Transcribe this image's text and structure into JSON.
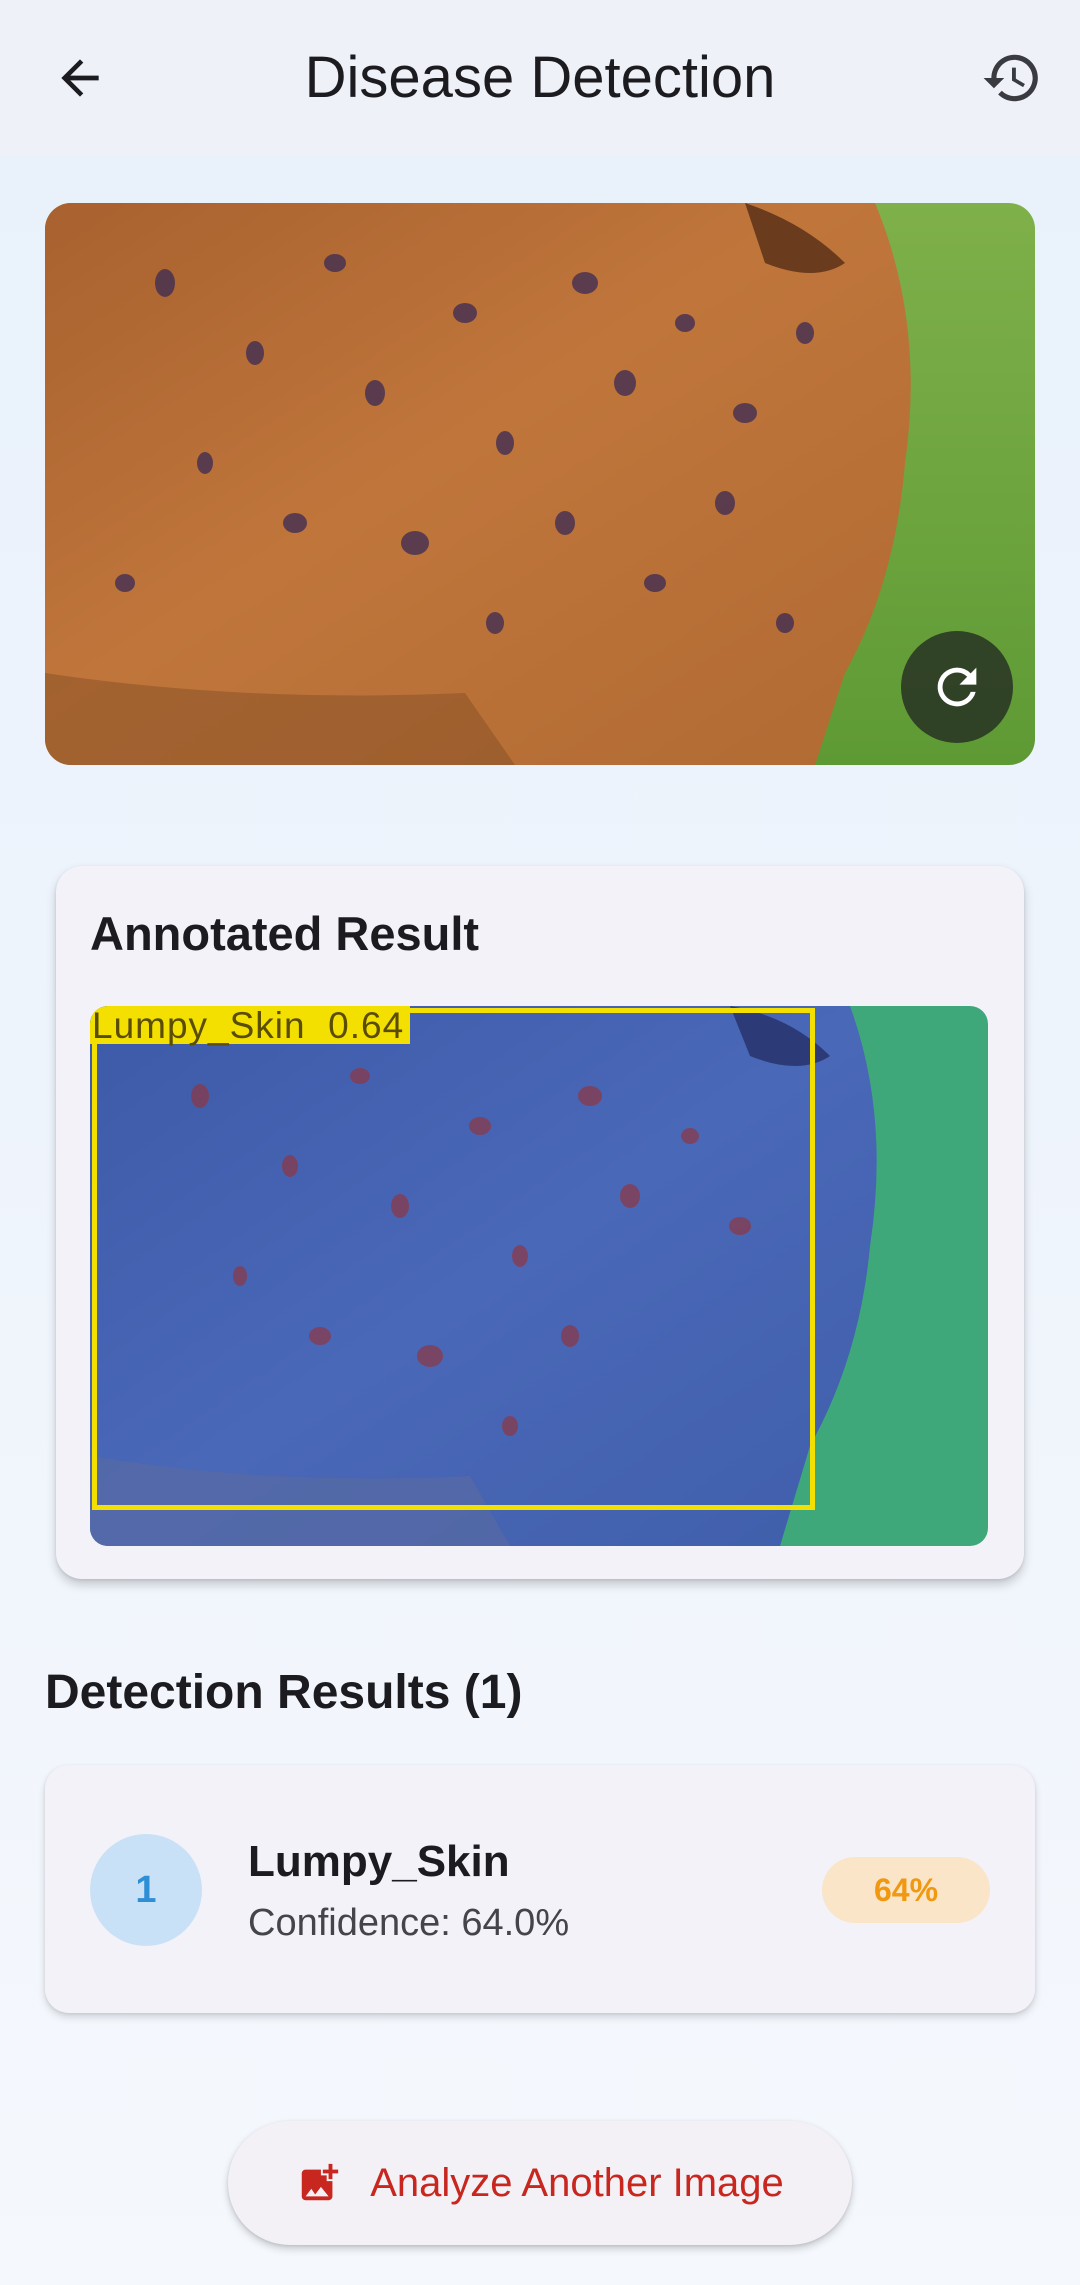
{
  "appbar": {
    "title": "Disease Detection",
    "back_icon": "arrow-back-icon",
    "history_icon": "history-icon"
  },
  "photo": {
    "refresh_icon": "refresh-icon"
  },
  "annotated": {
    "title": "Annotated Result",
    "detection_label": "Lumpy_Skin  0.64",
    "box_color": "#f3e000"
  },
  "results": {
    "section_title": "Detection Results (1)",
    "items": [
      {
        "rank": "1",
        "name": "Lumpy_Skin",
        "confidence_text": "Confidence: 64.0%",
        "badge": "64%",
        "confidence": 0.64
      }
    ]
  },
  "actions": {
    "analyze_label": "Analyze Another Image",
    "analyze_icon": "add-photo-icon",
    "accent_color": "#c8271f"
  }
}
